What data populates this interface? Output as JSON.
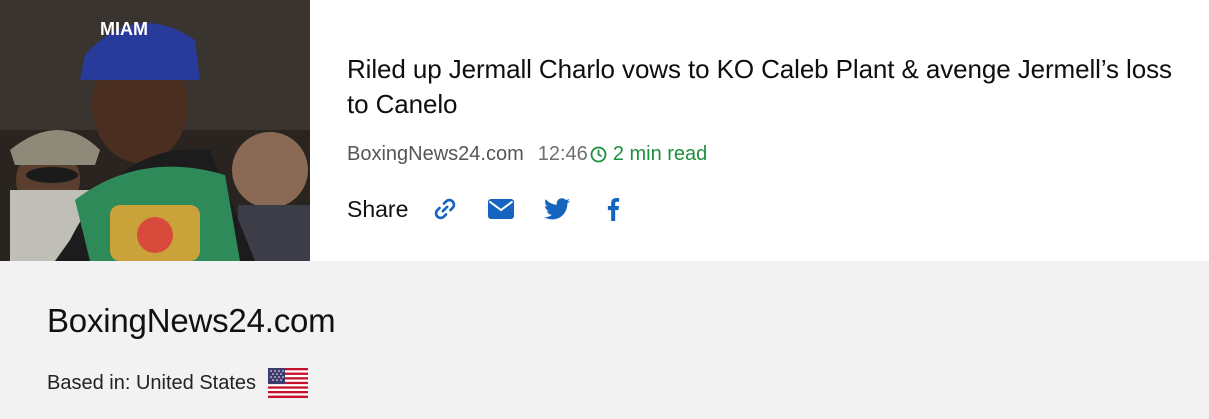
{
  "article": {
    "headline": "Riled up Jermall Charlo vows to KO Caleb Plant & avenge Jermell’s loss to Canelo",
    "source": "BoxingNews24.com",
    "time": "12:46",
    "read_time": "2 min read",
    "thumbnail": "boxer-photo"
  },
  "share": {
    "label": "Share",
    "buttons": [
      "link-icon",
      "email-icon",
      "twitter-icon",
      "facebook-icon"
    ]
  },
  "publisher": {
    "name": "BoxingNews24.com",
    "based_in_label": "Based in: United States",
    "flag": "us-flag-icon"
  },
  "colors": {
    "accent_blue": "#1565c0",
    "read_green": "#1e8f3d",
    "footer_bg": "#f2f2f2"
  }
}
